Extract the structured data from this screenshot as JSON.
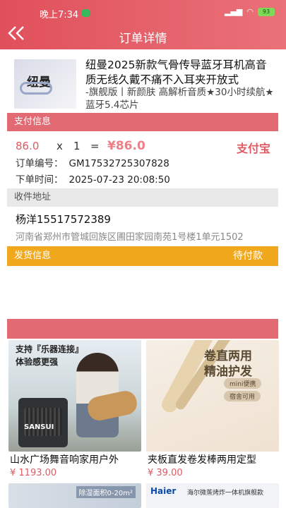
{
  "status_bar": {
    "time": "晚上7:34",
    "battery": "93"
  },
  "header": {
    "title": "订单详情",
    "back_icon": "double-chevron-left"
  },
  "product": {
    "thumb_brand": "纽曼",
    "name": "纽曼2025新款气骨传导蓝牙耳机高音质无线久戴不痛不入耳夹开放式",
    "desc": "-旗舰版丨新颜肤 高解析音质★30小时续航★蓝牙5.4芯片"
  },
  "payment": {
    "section_label": "支付信息",
    "unit_price": "86.0",
    "times": "x",
    "quantity": "1",
    "equals": "=",
    "total": "¥86.0",
    "method": "支付宝",
    "order_no_label": "订单编号：",
    "order_no": "GM17532725307828",
    "order_time_label": "下单时间：",
    "order_time": "2025-07-23 20:08:50"
  },
  "address": {
    "section_label": "收件地址",
    "name_phone": "杨洋15517572389",
    "detail": "河南省郑州市管城回族区圃田家园南苑1号楼1单元1502"
  },
  "shipping": {
    "section_label": "发货信息",
    "status": "待付款"
  },
  "recommendations": [
    {
      "title": "山水广场舞音响家用户外",
      "price": "¥ 1193.00",
      "banner1": "支持『乐器连接』",
      "banner2": "体验感更强",
      "logo": "SANSUI"
    },
    {
      "title": "夹板直发卷发棒两用定型",
      "price": "¥ 39.00",
      "banner1": "卷直两用",
      "banner2": "精油护发",
      "pill1": "mini便携",
      "pill2": "宿舍可用"
    },
    {
      "banner": "除湿面积0-20m²"
    },
    {
      "brand": "Haier",
      "banner": "海尔微蒸烤炸一体机旗舰款"
    }
  ],
  "colors": {
    "accent": "#e26a72",
    "ship_bar": "#f2a81d",
    "price": "#e05a63"
  }
}
